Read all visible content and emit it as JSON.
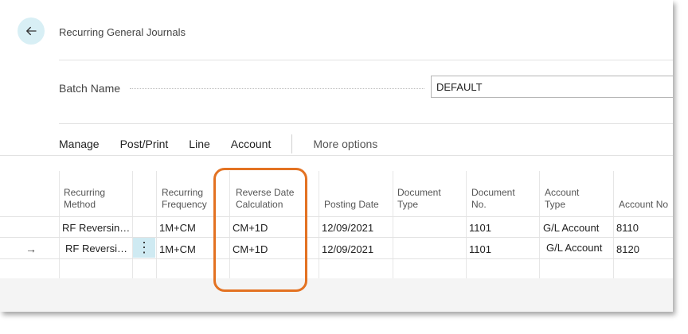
{
  "header": {
    "title": "Recurring General Journals"
  },
  "batch": {
    "label": "Batch Name",
    "value": "DEFAULT"
  },
  "actions": {
    "manage": "Manage",
    "post_print": "Post/Print",
    "line": "Line",
    "account": "Account",
    "more": "More options"
  },
  "columns": {
    "recurring_method": [
      "Recurring",
      "Method"
    ],
    "recurring_frequency": [
      "Recurring",
      "Frequency"
    ],
    "reverse_date_calculation": [
      "Reverse Date",
      "Calculation"
    ],
    "posting_date": "Posting Date",
    "document_type": [
      "Document",
      "Type"
    ],
    "document_no": [
      "Document",
      "No."
    ],
    "account_type": [
      "Account",
      "Type"
    ],
    "account_no": "Account No"
  },
  "rows": [
    {
      "recurring_method": "RF Reversin…",
      "recurring_frequency": "1M+CM",
      "reverse_date_calculation": "CM+1D",
      "posting_date": "12/09/2021",
      "document_type": "",
      "document_no": "1101",
      "account_type": "G/L Account",
      "account_no": "8110"
    },
    {
      "recurring_method": "RF Reversi…",
      "recurring_frequency": "1M+CM",
      "reverse_date_calculation": "CM+1D",
      "posting_date": "12/09/2021",
      "document_type": "",
      "document_no": "1101",
      "account_type": "G/L Account",
      "account_no": "8120"
    }
  ],
  "icons": {
    "back": "back-arrow-icon",
    "row_indicator": "arrow-right-icon",
    "row_menu": "more-vertical-icon"
  },
  "colors": {
    "accent": "#e37222",
    "selection": "#cfeaf2"
  }
}
